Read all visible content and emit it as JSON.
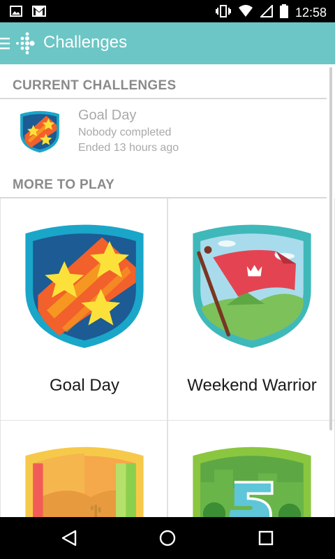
{
  "status_bar": {
    "time": "12:58",
    "icons": [
      "image-icon",
      "gmail-icon",
      "vibrate-icon",
      "wifi-icon",
      "signal-icon",
      "battery-icon"
    ]
  },
  "app_bar": {
    "title": "Challenges",
    "icons": [
      "menu-icon",
      "fitbit-logo"
    ],
    "color": "#6cc6c6"
  },
  "current_challenges": {
    "header": "CURRENT CHALLENGES",
    "items": [
      {
        "title": "Goal Day",
        "status": "Nobody completed",
        "ended": "Ended 13 hours ago",
        "badge": "goal-day-badge"
      }
    ]
  },
  "more_to_play": {
    "header": "MORE TO PLAY",
    "items": [
      {
        "label": "Goal Day",
        "badge": "goal-day-badge"
      },
      {
        "label": "Weekend Warrior",
        "badge": "weekend-warrior-badge"
      },
      {
        "label": "",
        "badge": "desert-road-badge"
      },
      {
        "label": "",
        "badge": "five-badge"
      }
    ]
  },
  "nav_bar": {
    "icons": [
      "back-icon",
      "home-icon",
      "recents-icon"
    ]
  }
}
